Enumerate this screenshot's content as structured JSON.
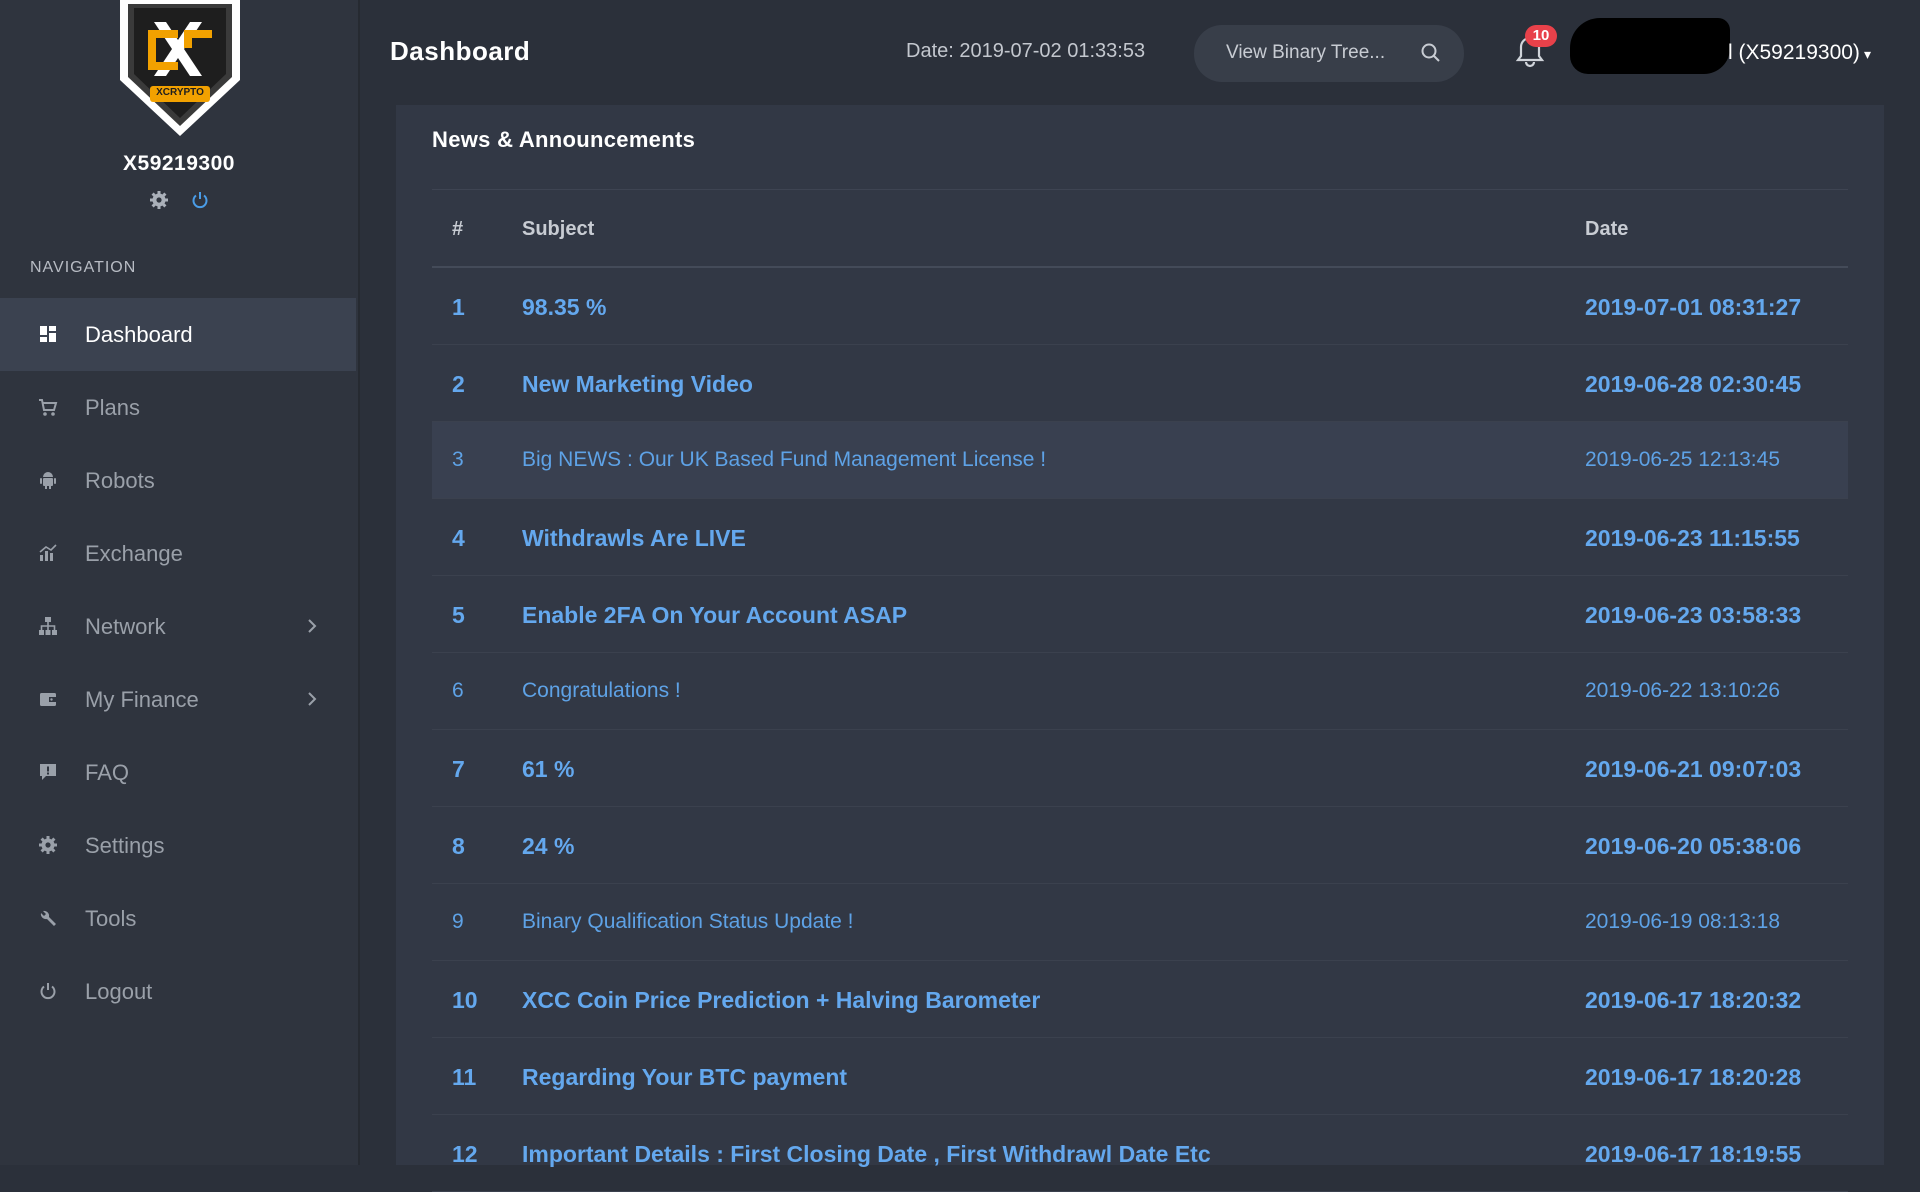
{
  "sidebar": {
    "logo_text": "XCRYPTO",
    "username": "X59219300",
    "nav_heading": "NAVIGATION",
    "items": [
      {
        "label": "Dashboard",
        "icon": "dashboard-icon",
        "active": true
      },
      {
        "label": "Plans",
        "icon": "cart-icon"
      },
      {
        "label": "Robots",
        "icon": "robot-icon"
      },
      {
        "label": "Exchange",
        "icon": "chart-icon"
      },
      {
        "label": "Network",
        "icon": "sitemap-icon",
        "has_submenu": true
      },
      {
        "label": "My Finance",
        "icon": "wallet-icon",
        "has_submenu": true
      },
      {
        "label": "FAQ",
        "icon": "faq-icon"
      },
      {
        "label": "Settings",
        "icon": "gear-icon"
      },
      {
        "label": "Tools",
        "icon": "wrench-icon"
      },
      {
        "label": "Logout",
        "icon": "power-icon"
      }
    ]
  },
  "header": {
    "title": "Dashboard",
    "date": "Date: 2019-07-02 01:33:53",
    "search_placeholder": "View Binary Tree...",
    "notifications_count": "10",
    "user_label": "l (X59219300)"
  },
  "news": {
    "title": "News & Announcements",
    "columns": {
      "num": "#",
      "subject": "Subject",
      "date": "Date"
    },
    "rows": [
      {
        "num": "1",
        "subject": "98.35 %",
        "date": "2019-07-01 08:31:27",
        "bold": true
      },
      {
        "num": "2",
        "subject": "New Marketing Video",
        "date": "2019-06-28 02:30:45",
        "bold": true
      },
      {
        "num": "3",
        "subject": "Big NEWS : Our UK Based Fund Management License !",
        "date": "2019-06-25 12:13:45",
        "bold": false
      },
      {
        "num": "4",
        "subject": "Withdrawls Are LIVE",
        "date": "2019-06-23 11:15:55",
        "bold": true
      },
      {
        "num": "5",
        "subject": "Enable 2FA On Your Account ASAP",
        "date": "2019-06-23 03:58:33",
        "bold": true
      },
      {
        "num": "6",
        "subject": "Congratulations !",
        "date": "2019-06-22 13:10:26",
        "bold": false
      },
      {
        "num": "7",
        "subject": "61 %",
        "date": "2019-06-21 09:07:03",
        "bold": true
      },
      {
        "num": "8",
        "subject": "24 %",
        "date": "2019-06-20 05:38:06",
        "bold": true
      },
      {
        "num": "9",
        "subject": "Binary Qualification Status Update !",
        "date": "2019-06-19 08:13:18",
        "bold": false
      },
      {
        "num": "10",
        "subject": "XCC Coin Price Prediction + Halving Barometer",
        "date": "2019-06-17 18:20:32",
        "bold": true
      },
      {
        "num": "11",
        "subject": "Regarding Your BTC payment",
        "date": "2019-06-17 18:20:28",
        "bold": true
      },
      {
        "num": "12",
        "subject": "Important Details : First Closing Date , First Withdrawl Date Etc",
        "date": "2019-06-17 18:19:55",
        "bold": true
      }
    ]
  },
  "colors": {
    "sidebar_bg": "#2f343e",
    "main_bg": "#2b303a",
    "card_bg": "#323845",
    "link": "#64a8ee",
    "badge": "#e8414a",
    "logo_gold": "#f2a100"
  }
}
